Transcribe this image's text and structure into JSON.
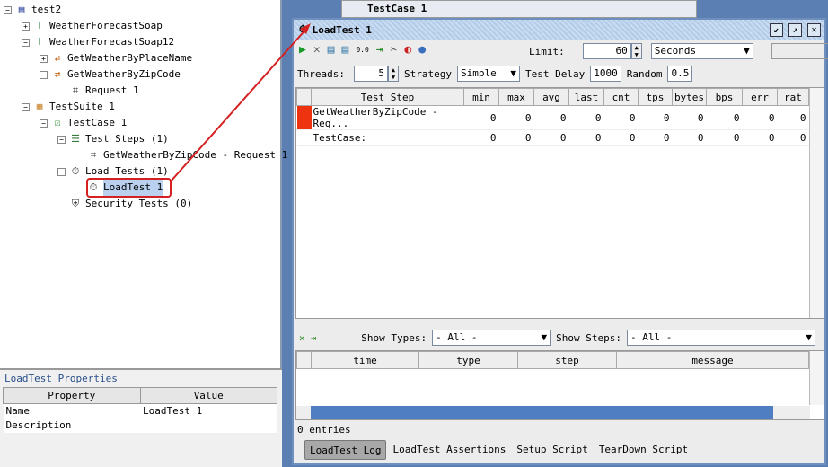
{
  "tree": [
    {
      "label": "test2",
      "icon": "project-icon",
      "indent": 0,
      "exp": "-"
    },
    {
      "label": "WeatherForecastSoap",
      "icon": "interface-icon",
      "indent": 1,
      "exp": "+"
    },
    {
      "label": "WeatherForecastSoap12",
      "icon": "interface-icon",
      "indent": 1,
      "exp": "-"
    },
    {
      "label": "GetWeatherByPlaceName",
      "icon": "operation-icon",
      "indent": 2,
      "exp": "+"
    },
    {
      "label": "GetWeatherByZipCode",
      "icon": "operation-icon",
      "indent": 2,
      "exp": "-"
    },
    {
      "label": "Request 1",
      "icon": "soap-request-icon",
      "indent": 3,
      "exp": ""
    },
    {
      "label": "TestSuite 1",
      "icon": "testsuite-icon",
      "indent": 1,
      "exp": "-"
    },
    {
      "label": "TestCase 1",
      "icon": "testcase-icon",
      "indent": 2,
      "exp": "-"
    },
    {
      "label": "Test Steps (1)",
      "icon": "teststeps-icon",
      "indent": 3,
      "exp": "-"
    },
    {
      "label": "GetWeatherByZipCode - Request 1",
      "icon": "soap-request-icon",
      "indent": 4,
      "exp": ""
    },
    {
      "label": "Load Tests (1)",
      "icon": "stopwatch-icon",
      "indent": 3,
      "exp": "-"
    },
    {
      "label": "LoadTest 1",
      "icon": "stopwatch-icon",
      "indent": 4,
      "exp": "",
      "selected": true
    },
    {
      "label": "Security Tests (0)",
      "icon": "shield-icon",
      "indent": 3,
      "exp": ""
    }
  ],
  "properties": {
    "title": "LoadTest Properties",
    "headers": [
      "Property",
      "Value"
    ],
    "rows": [
      [
        "Name",
        "LoadTest 1"
      ],
      [
        "Description",
        ""
      ]
    ]
  },
  "background_window": {
    "title": "TestCase 1"
  },
  "window": {
    "title": "LoadTest 1"
  },
  "toolbar": {
    "limit_label": "Limit:",
    "limit_value": "60",
    "limit_unit": "Seconds"
  },
  "config": {
    "threads_label": "Threads:",
    "threads": "5",
    "strategy_label": "Strategy",
    "strategy": "Simple",
    "delay_label": "Test Delay",
    "delay": "1000",
    "random_label": "Random",
    "random": "0.5"
  },
  "stats": {
    "headers": [
      "Test Step",
      "min",
      "max",
      "avg",
      "last",
      "cnt",
      "tps",
      "bytes",
      "bps",
      "err",
      "rat"
    ],
    "rows": [
      [
        "GetWeatherByZipCode - Req...",
        "0",
        "0",
        "0",
        "0",
        "0",
        "0",
        "0",
        "0",
        "0",
        "0"
      ],
      [
        "TestCase:",
        "0",
        "0",
        "0",
        "0",
        "0",
        "0",
        "0",
        "0",
        "0",
        "0"
      ]
    ],
    "row_color": "#ee3311"
  },
  "log": {
    "show_types_label": "Show Types:",
    "show_types": "- All -",
    "show_steps_label": "Show Steps:",
    "show_steps": "- All -",
    "headers": [
      "time",
      "type",
      "step",
      "message"
    ],
    "entries": "0 entries"
  },
  "tabs": [
    "LoadTest Log",
    "LoadTest Assertions",
    "Setup Script",
    "TearDown Script"
  ],
  "annotation_color": "#d42020"
}
